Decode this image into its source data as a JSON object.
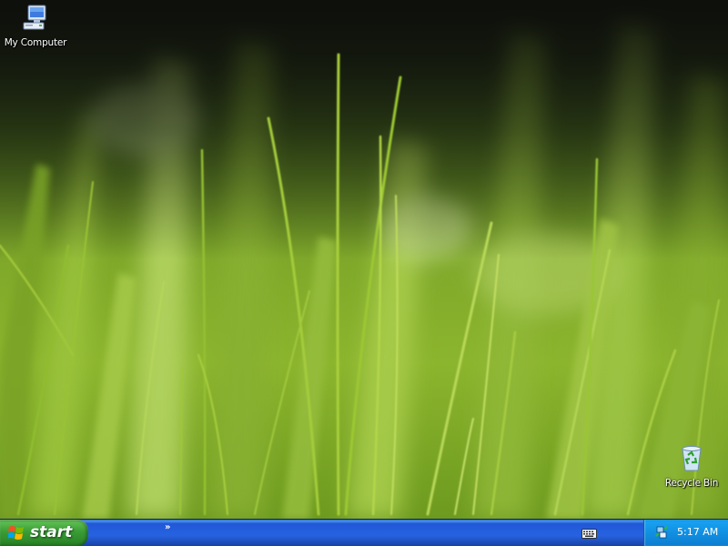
{
  "desktop": {
    "icons": [
      {
        "label": "My Computer",
        "icon": "my-computer-icon"
      },
      {
        "label": "Recycle Bin",
        "icon": "recycle-bin-icon"
      }
    ]
  },
  "taskbar": {
    "start_label": "start",
    "quicklaunch_chevron": "»",
    "tray": {
      "icons": [
        "keyboard-icon",
        "network-icon"
      ],
      "clock": "5:17 AM"
    }
  },
  "colors": {
    "taskbar_blue": "#2663e0",
    "start_green": "#3a9d35",
    "tray_blue": "#1190e2",
    "wallpaper_green": "#7fa82a"
  }
}
